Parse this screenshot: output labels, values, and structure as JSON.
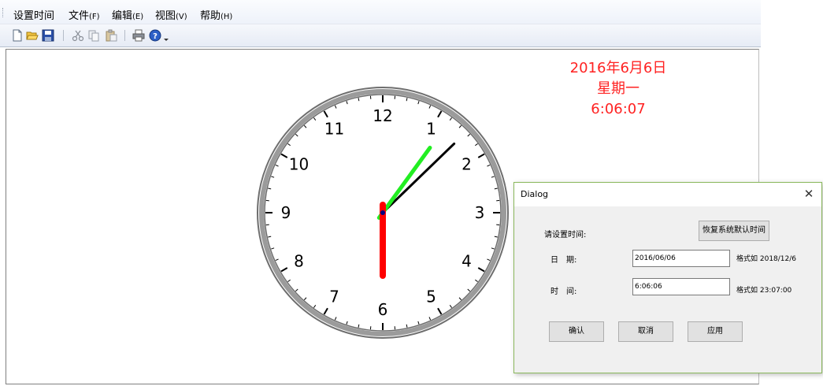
{
  "menubar": {
    "items": [
      {
        "label": "设置时间",
        "accel": ""
      },
      {
        "label": "文件",
        "accel": "(F)"
      },
      {
        "label": "编辑",
        "accel": "(E)"
      },
      {
        "label": "视图",
        "accel": "(V)"
      },
      {
        "label": "帮助",
        "accel": "(H)"
      }
    ]
  },
  "toolbar": {
    "buttons": [
      "new-icon",
      "open-icon",
      "save-icon",
      "cut-icon",
      "copy-icon",
      "paste-icon",
      "print-icon",
      "about-icon",
      "toolbar-overflow-icon"
    ]
  },
  "clock": {
    "numbers": [
      "12",
      "1",
      "2",
      "3",
      "4",
      "5",
      "6",
      "7",
      "8",
      "9",
      "10",
      "11"
    ],
    "time": {
      "hour": 6,
      "minute": 6,
      "second": 7
    },
    "colors": {
      "hour_hand": "#ff0000",
      "minute_hand": "#000000",
      "second_hand": "#22ee22",
      "rim": "#808080",
      "center": "#000080"
    }
  },
  "date_display": {
    "date": "2016年6月6日",
    "weekday": "星期一",
    "time": "6:06:07",
    "color": "#ff2222"
  },
  "dialog": {
    "title": "Dialog",
    "close_symbol": "✕",
    "prompt": "请设置时间:",
    "restore_button": "恢复系统默认时间",
    "date_label": "日　期:",
    "date_value": "2016/06/06",
    "date_hint": "格式如 2018/12/6",
    "time_label": "时　间:",
    "time_value": "6:06:06",
    "time_hint": "格式如 23:07:00",
    "confirm_button": "确认",
    "cancel_button": "取消",
    "apply_button": "应用"
  }
}
